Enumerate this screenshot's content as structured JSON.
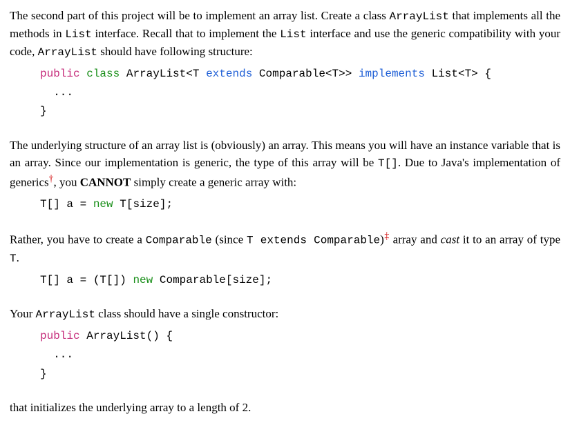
{
  "para1": {
    "t1": "The second part of this project will be to implement an array list. Create a class ",
    "c1": "ArrayList",
    "t2": " that implements all the methods in ",
    "c2": "List",
    "t3": " interface. Recall that to implement the ",
    "c3": "List",
    "t4": " interface and use the generic compatibility with your code, ",
    "c4": "ArrayList",
    "t5": " should have following structure:"
  },
  "codeblock1": {
    "kw_public": "public",
    "kw_class": "class",
    "name": "ArrayList<T",
    "kw_extends": "extends",
    "comp": "Comparable<T>>",
    "kw_implements": "implements",
    "listt": "List<T> {",
    "ellipsis": "  ...",
    "close": "}"
  },
  "para2": {
    "t1": "The underlying structure of an array list is (obviously) an array. This means you will have an instance variable that is an array. Since our implementation is generic, the type of this array will be ",
    "c1": "T[]",
    "t2": ". Due to Java's implementation of generics",
    "dagger": "†",
    "t3": ", you ",
    "cannot": "CANNOT",
    "t4": " simply create a generic array with:"
  },
  "codeblock2": {
    "lhs": "T[] a =",
    "kw_new": "new",
    "rhs": "T[size];"
  },
  "para3": {
    "t1": "Rather, you have to create a ",
    "c1": "Comparable",
    "t2": " (since ",
    "c2": "T extends Comparable",
    "t3": ")",
    "dagger": "‡",
    "t4": " array and ",
    "cast": "cast",
    "t5": " it to an array of type ",
    "c3": "T",
    "t6": "."
  },
  "codeblock3": {
    "lhs": "T[] a = (T[])",
    "kw_new": "new",
    "rhs": "Comparable[size];"
  },
  "para4": {
    "t1": "Your ",
    "c1": "ArrayList",
    "t2": " class should have a single constructor:"
  },
  "codeblock4": {
    "kw_public": "public",
    "name": "ArrayList() {",
    "ellipsis": "  ...",
    "close": "}"
  },
  "para5": {
    "t1": "that initializes the underlying array to a length of 2."
  }
}
